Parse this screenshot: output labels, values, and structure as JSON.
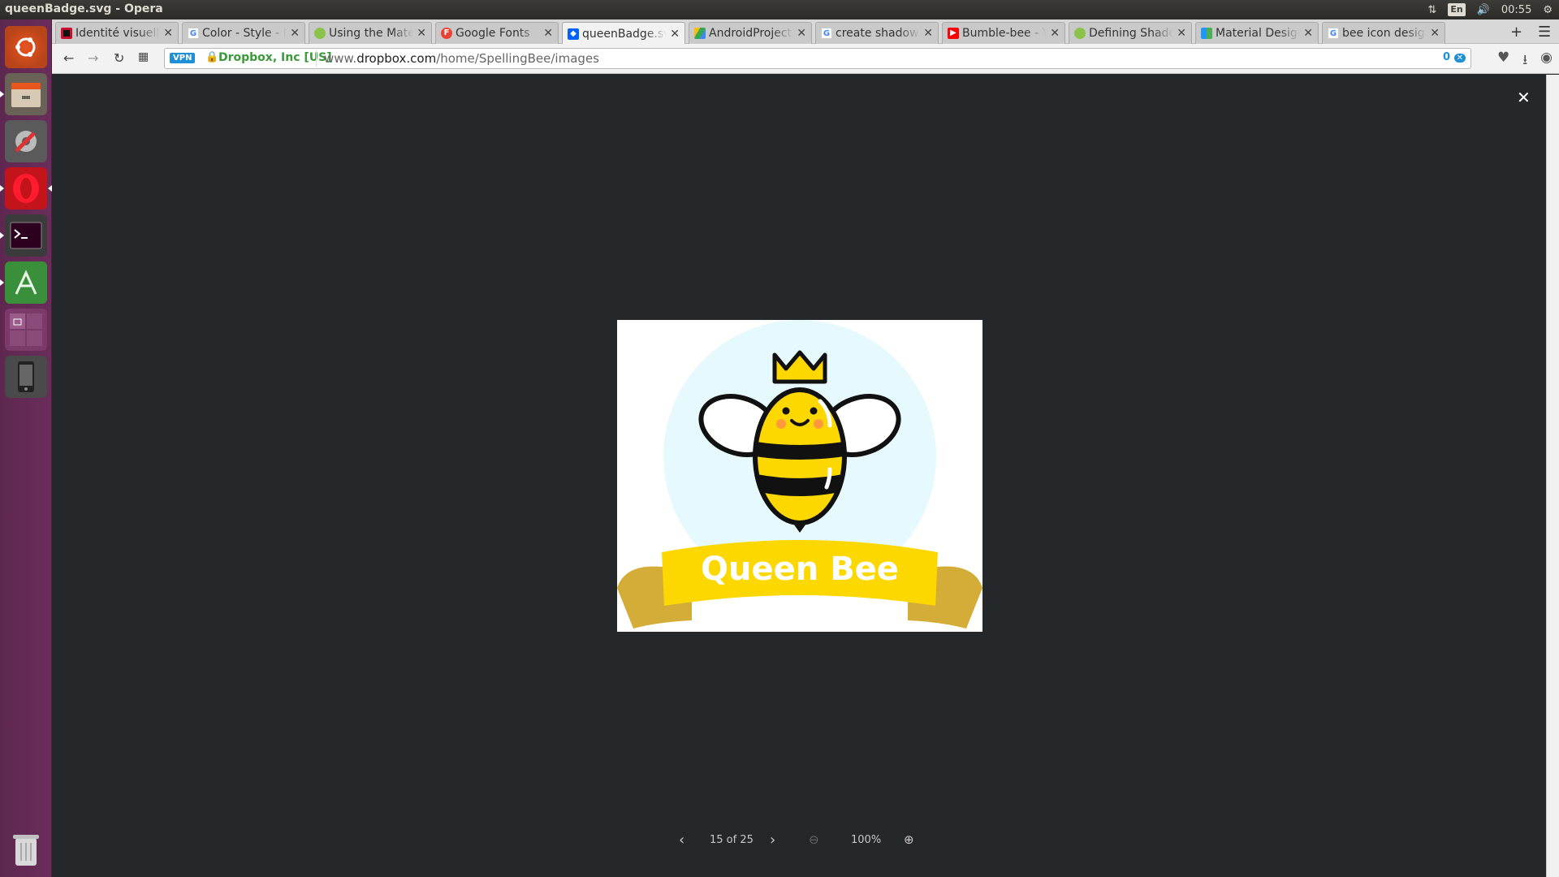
{
  "window": {
    "title": "queenBadge.svg - Opera"
  },
  "panel": {
    "lang": "En",
    "time": "00:55"
  },
  "tabs": [
    {
      "label": "Identité visuelle",
      "favicon": "#c8102e"
    },
    {
      "label": "Color - Style - Ma",
      "favicon": "google"
    },
    {
      "label": "Using the Mater",
      "favicon": "#8bc34a"
    },
    {
      "label": "Google Fonts",
      "favicon": "#ea4335"
    },
    {
      "label": "queenBadge.svg",
      "favicon": "#0061fe"
    },
    {
      "label": "AndroidProject",
      "favicon": "#4caf50"
    },
    {
      "label": "create shadow",
      "favicon": "google"
    },
    {
      "label": "Bumble-bee - Yo",
      "favicon": "#ff0000"
    },
    {
      "label": "Defining Shado",
      "favicon": "#8bc34a"
    },
    {
      "label": "Material Design",
      "favicon": "#2196f3"
    },
    {
      "label": "bee icon design",
      "favicon": "google"
    }
  ],
  "address": {
    "vpn": "VPN",
    "site_identity": "Dropbox, Inc [US]",
    "url_prefix": "www.",
    "url_domain": "dropbox.com",
    "url_path": "/home/SpellingBee/images",
    "adblock_count": "0"
  },
  "viewer": {
    "badge_text": "Queen Bee",
    "page_indicator": "15 of 25",
    "zoom": "100%"
  },
  "colors": {
    "viewer_bg": "#24282b",
    "badge_yellow": "#fcd800",
    "ribbon_dark": "#d4ad38",
    "launcher": "#5e2750"
  }
}
